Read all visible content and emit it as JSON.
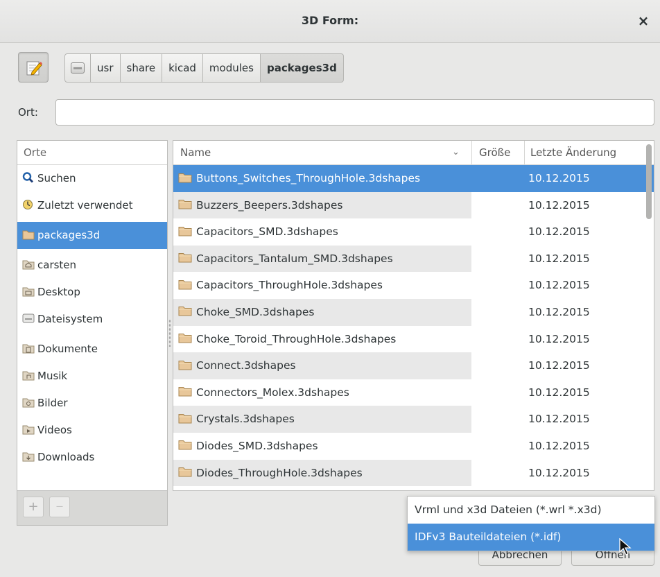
{
  "window": {
    "title": "3D Form:",
    "close_glyph": "×"
  },
  "pathbar": {
    "segments": [
      "usr",
      "share",
      "kicad",
      "modules",
      "packages3d"
    ],
    "active_index": 4
  },
  "location": {
    "label": "Ort:",
    "value": "",
    "placeholder": ""
  },
  "sidebar": {
    "header": "Orte",
    "items": [
      {
        "label": "Suchen",
        "icon": "search-icon"
      },
      {
        "label": "Zuletzt verwendet",
        "icon": "recent-icon"
      },
      {
        "label": "packages3d",
        "icon": "folder-icon",
        "selected": true
      },
      {
        "label": "carsten",
        "icon": "home-folder-icon"
      },
      {
        "label": "Desktop",
        "icon": "desktop-folder-icon"
      },
      {
        "label": "Dateisystem",
        "icon": "drive-icon"
      },
      {
        "label": "Dokumente",
        "icon": "documents-folder-icon"
      },
      {
        "label": "Musik",
        "icon": "music-folder-icon"
      },
      {
        "label": "Bilder",
        "icon": "pictures-folder-icon"
      },
      {
        "label": "Videos",
        "icon": "videos-folder-icon"
      },
      {
        "label": "Downloads",
        "icon": "downloads-folder-icon"
      }
    ],
    "add_glyph": "+",
    "remove_glyph": "—"
  },
  "filelist": {
    "columns": {
      "name": "Name",
      "size": "Größe",
      "modified": "Letzte Änderung"
    },
    "sort_glyph": "⌄",
    "rows": [
      {
        "name": "Buttons_Switches_ThroughHole.3dshapes",
        "size": "",
        "modified": "10.12.2015",
        "selected": true
      },
      {
        "name": "Buzzers_Beepers.3dshapes",
        "size": "",
        "modified": "10.12.2015"
      },
      {
        "name": "Capacitors_SMD.3dshapes",
        "size": "",
        "modified": "10.12.2015"
      },
      {
        "name": "Capacitors_Tantalum_SMD.3dshapes",
        "size": "",
        "modified": "10.12.2015"
      },
      {
        "name": "Capacitors_ThroughHole.3dshapes",
        "size": "",
        "modified": "10.12.2015"
      },
      {
        "name": "Choke_SMD.3dshapes",
        "size": "",
        "modified": "10.12.2015"
      },
      {
        "name": "Choke_Toroid_ThroughHole.3dshapes",
        "size": "",
        "modified": "10.12.2015"
      },
      {
        "name": "Connect.3dshapes",
        "size": "",
        "modified": "10.12.2015"
      },
      {
        "name": "Connectors_Molex.3dshapes",
        "size": "",
        "modified": "10.12.2015"
      },
      {
        "name": "Crystals.3dshapes",
        "size": "",
        "modified": "10.12.2015"
      },
      {
        "name": "Diodes_SMD.3dshapes",
        "size": "",
        "modified": "10.12.2015"
      },
      {
        "name": "Diodes_ThroughHole.3dshapes",
        "size": "",
        "modified": "10.12.2015"
      }
    ]
  },
  "filter_dropdown": {
    "options": [
      {
        "label": "Vrml und x3d Dateien (*.wrl *.x3d)"
      },
      {
        "label": "IDFv3 Bauteildateien (*.idf)",
        "selected": true
      }
    ]
  },
  "buttons": {
    "cancel": "Abbrechen",
    "open": "Öffnen"
  },
  "colors": {
    "selection": "#4a90d9",
    "folder": "#e8c79a",
    "alt_row": "#e8e8e8"
  }
}
